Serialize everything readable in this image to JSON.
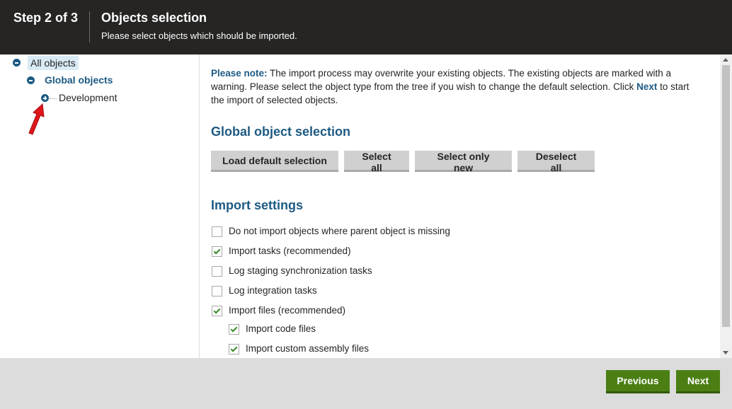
{
  "header": {
    "step": "Step 2 of 3",
    "title": "Objects selection",
    "subtitle": "Please select objects which should be imported."
  },
  "tree": {
    "root": "All objects",
    "global": "Global objects",
    "development": "Development"
  },
  "note": {
    "lead": "Please note:",
    "line1": " The import process may overwrite your existing objects. The existing objects are marked with a warning. Please select the object type from the tree if you wish to change the default selection. Click ",
    "next_word": "Next",
    "line2": " to start the import of selected objects."
  },
  "global_selection": {
    "heading": "Global object selection",
    "buttons": [
      "Load default selection",
      "Select all",
      "Select only new",
      "Deselect all"
    ]
  },
  "import_settings": {
    "heading": "Import settings",
    "options": [
      {
        "label": "Do not import objects where parent object is missing",
        "checked": false
      },
      {
        "label": "Import tasks (recommended)",
        "checked": true
      },
      {
        "label": "Log staging synchronization tasks",
        "checked": false
      },
      {
        "label": "Log integration tasks",
        "checked": false
      },
      {
        "label": "Import files (recommended)",
        "checked": true
      },
      {
        "label": "Import code files",
        "checked": true
      },
      {
        "label": "Import custom assembly files",
        "checked": true
      }
    ]
  },
  "footer": {
    "previous": "Previous",
    "next": "Next"
  },
  "colors": {
    "header_bg": "#262524",
    "accent_blue": "#1d5a83",
    "green_button": "#4b7f14",
    "annotation_arrow": "#e0161b"
  }
}
